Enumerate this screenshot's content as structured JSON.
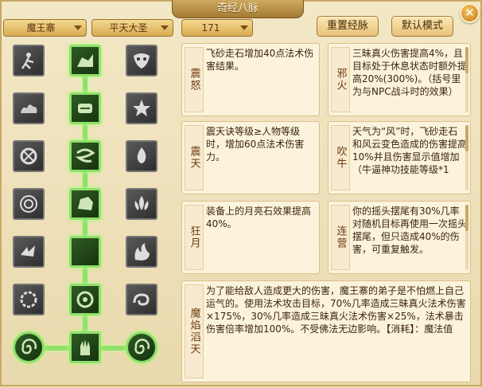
{
  "window": {
    "title": "奇经八脉",
    "close_label": "✕"
  },
  "controls": {
    "sect_dropdown": "魔王寨",
    "skill_dropdown": "平天大圣",
    "level_value": "171",
    "reset_button": "重置经脉",
    "default_button": "默认模式"
  },
  "colors": {
    "active_green": "#8fe06a",
    "panel_bg": "#fbf3dc",
    "title_bg": "#b48a42"
  },
  "tree": {
    "nodes": [
      {
        "id": "r1c1",
        "icon": "running-figure-icon",
        "active": false
      },
      {
        "id": "r1c2",
        "icon": "rock-slam-icon",
        "active": true
      },
      {
        "id": "r1c3",
        "icon": "demon-mask-icon",
        "active": false
      },
      {
        "id": "r2c1",
        "icon": "smoke-cloud-icon",
        "active": false
      },
      {
        "id": "r2c2",
        "icon": "scroll-blast-icon",
        "active": true
      },
      {
        "id": "r2c3",
        "icon": "burst-icon",
        "active": false
      },
      {
        "id": "r3c1",
        "icon": "sun-seal-icon",
        "active": false
      },
      {
        "id": "r3c2",
        "icon": "whirlwind-icon",
        "active": true
      },
      {
        "id": "r3c3",
        "icon": "flame-icon",
        "active": false
      },
      {
        "id": "r4c1",
        "icon": "rune-disc-icon",
        "active": false
      },
      {
        "id": "r4c2",
        "icon": "stone-icon",
        "active": true
      },
      {
        "id": "r4c3",
        "icon": "fire-lotus-icon",
        "active": false
      },
      {
        "id": "r5c1",
        "icon": "charge-icon",
        "active": false
      },
      {
        "id": "r5c2",
        "icon": "crescent-moon-icon",
        "active": true
      },
      {
        "id": "r5c3",
        "icon": "blaze-icon",
        "active": false
      },
      {
        "id": "r6c1",
        "icon": "ring-fire-icon",
        "active": false
      },
      {
        "id": "r6c2",
        "icon": "beast-ring-icon",
        "active": true
      },
      {
        "id": "r6c3",
        "icon": "swirl-cloud-icon",
        "active": false
      },
      {
        "id": "r7c1",
        "icon": "spiral-orb-icon",
        "active": true
      },
      {
        "id": "r7c2",
        "icon": "flame-hand-icon",
        "active": true
      },
      {
        "id": "r7c3",
        "icon": "spiral-orb-icon",
        "active": true
      }
    ]
  },
  "cards": [
    {
      "name": "震怒",
      "desc": "飞砂走石增加40点法术伤害结果。"
    },
    {
      "name": "邪火",
      "desc": "三昧真火伤害提高4%，且目标处于休息状态时额外提高20%(300%)。（括号里为与NPC战斗时的效果）"
    },
    {
      "name": "震天",
      "desc": "震天诀等级≥人物等级时，增加60点法术伤害力。"
    },
    {
      "name": "吹牛",
      "desc": "天气为“风”时，飞砂走石和风云变色造成的伤害提高10%并且伤害显示值增加（牛逼神功技能等级*1"
    },
    {
      "name": "狂月",
      "desc": "装备上的月亮石效果提高40%。"
    },
    {
      "name": "连营",
      "desc": "你的摇头摆尾有30%几率对随机目标再使用一次摇头摆尾，但只造成40%的伤害，可重复触发。"
    },
    {
      "name": "魔焰滔天",
      "desc": "为了能给敌人造成更大的伤害，魔王寨的弟子是不怕燃上自己运气的。使用法术攻击目标，70%几率造成三昧真火法术伤害×175%，30%几率造成三昧真火法术伤害×25%，法术暴击伤害倍率增加100%。不受佛法无边影响。【消耗】：魔法值"
    }
  ]
}
